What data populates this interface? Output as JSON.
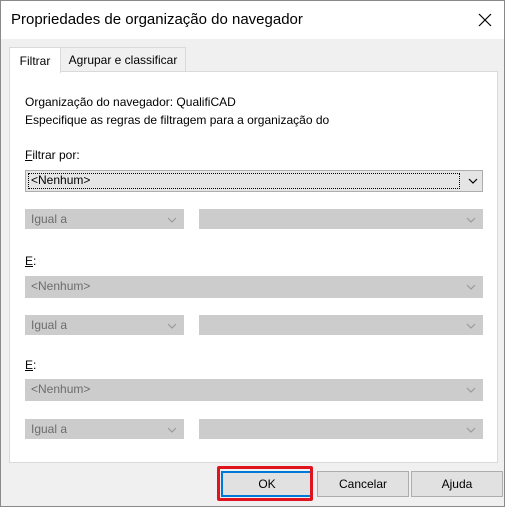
{
  "window": {
    "title": "Propriedades de organização do navegador"
  },
  "tabs": [
    {
      "label": "Filtrar"
    },
    {
      "label": "Agrupar e classificar"
    }
  ],
  "panel": {
    "org_line": "Organização do navegador: QualifiCAD",
    "desc_line": "Especifique as regras de filtragem para a organização do",
    "filter_by": {
      "accel": "F",
      "rest": "iltrar por:"
    },
    "filter_select": "<Nenhum>",
    "row1": {
      "operator": "Igual a",
      "value": ""
    },
    "and_label_1": {
      "accel": "E",
      "rest": ":"
    },
    "select_2": "<Nenhum>",
    "row2": {
      "operator": "Igual a",
      "value": ""
    },
    "and_label_2": {
      "accel": "E",
      "rest": ":"
    },
    "select_3": "<Nenhum>",
    "row3": {
      "operator": "Igual a",
      "value": ""
    }
  },
  "buttons": {
    "ok": "OK",
    "cancel": "Cancelar",
    "help": "Ajuda"
  },
  "colors": {
    "highlight": "#e0141e",
    "accent": "#0078d7"
  }
}
